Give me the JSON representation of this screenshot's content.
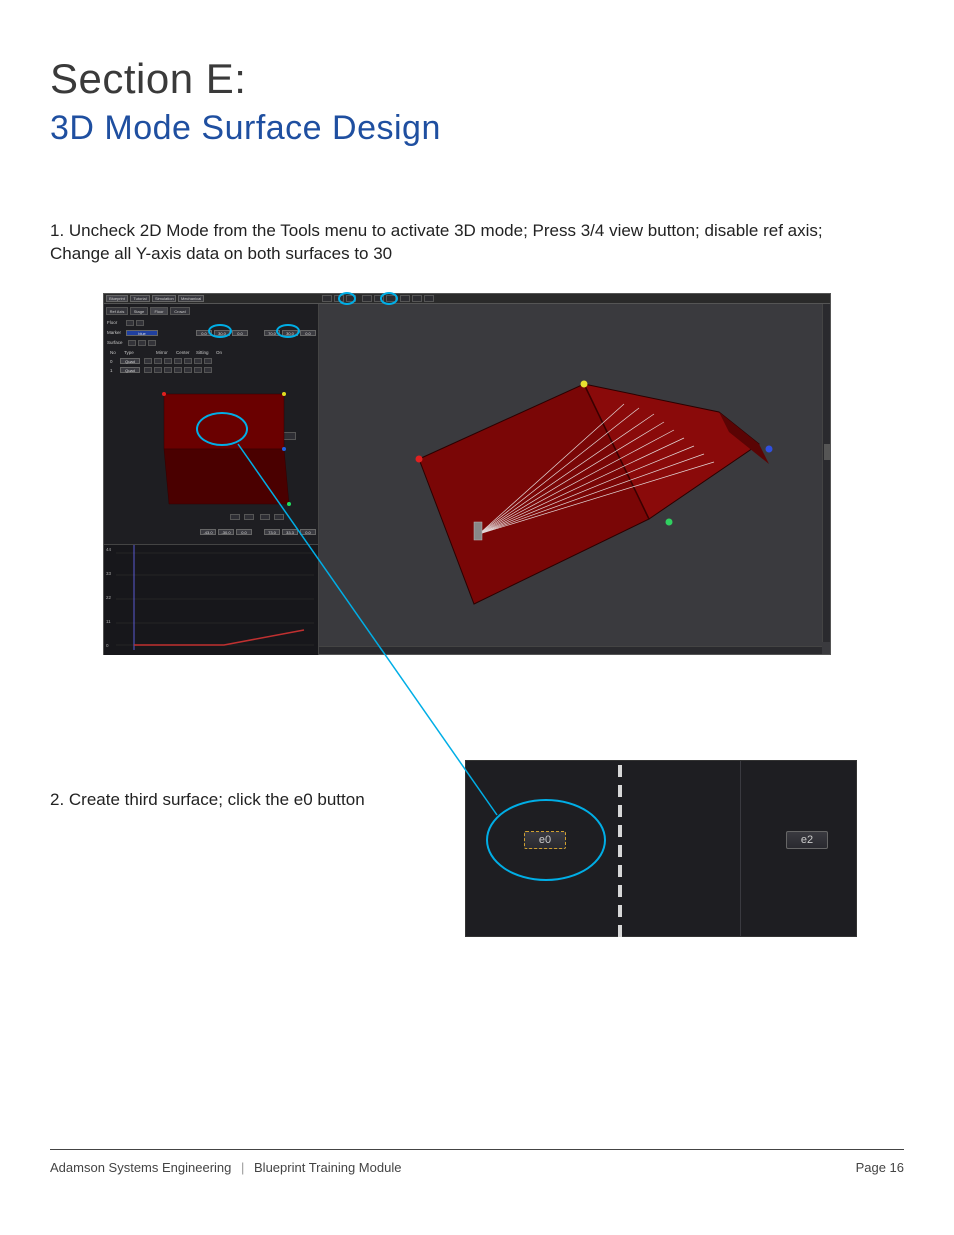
{
  "heading": {
    "section": "Section E:",
    "title": "3D Mode Surface Design"
  },
  "steps": {
    "s1": "1. Uncheck 2D Mode from the Tools menu to activate 3D mode; Press 3/4 view button; disable ref axis; Change all Y-axis data on both surfaces to 30",
    "s2": "2. Create third surface; click the e0 button"
  },
  "screenshot1": {
    "main_tabs": [
      "Blueprint",
      "Tutorial",
      "Simulation",
      "Mechanical"
    ],
    "sub_tabs": [
      "Ref Axis",
      "Stage",
      "Floor",
      "Crowd"
    ],
    "rows": {
      "floor": "Floor",
      "marker": "Marker",
      "surface": "Surface",
      "no": "No",
      "type": "Type",
      "mirror": "Mirror",
      "center": "Center",
      "sitting": "Sitting",
      "on": "On"
    },
    "marker_select": "blue",
    "marker_vals": [
      "0.0",
      "30.0",
      "0.0",
      "70.0",
      "30.0",
      "0.0"
    ],
    "surface_rows": [
      {
        "n": "0",
        "type": "Quad"
      },
      {
        "n": "1",
        "type": "Quad"
      }
    ],
    "bottom_inputs_left": [
      "-43.0",
      "-30.0",
      "0.0"
    ],
    "bottom_inputs_right": [
      "73.0",
      "33.3",
      "0.0"
    ],
    "graph_y": [
      "44",
      "33",
      "22",
      "11",
      "0"
    ]
  },
  "screenshot2": {
    "btn_eo": "e0",
    "btn_e2": "e2"
  },
  "footer": {
    "company": "Adamson Systems Engineering",
    "module": "Blueprint Training Module",
    "page": "Page 16"
  }
}
